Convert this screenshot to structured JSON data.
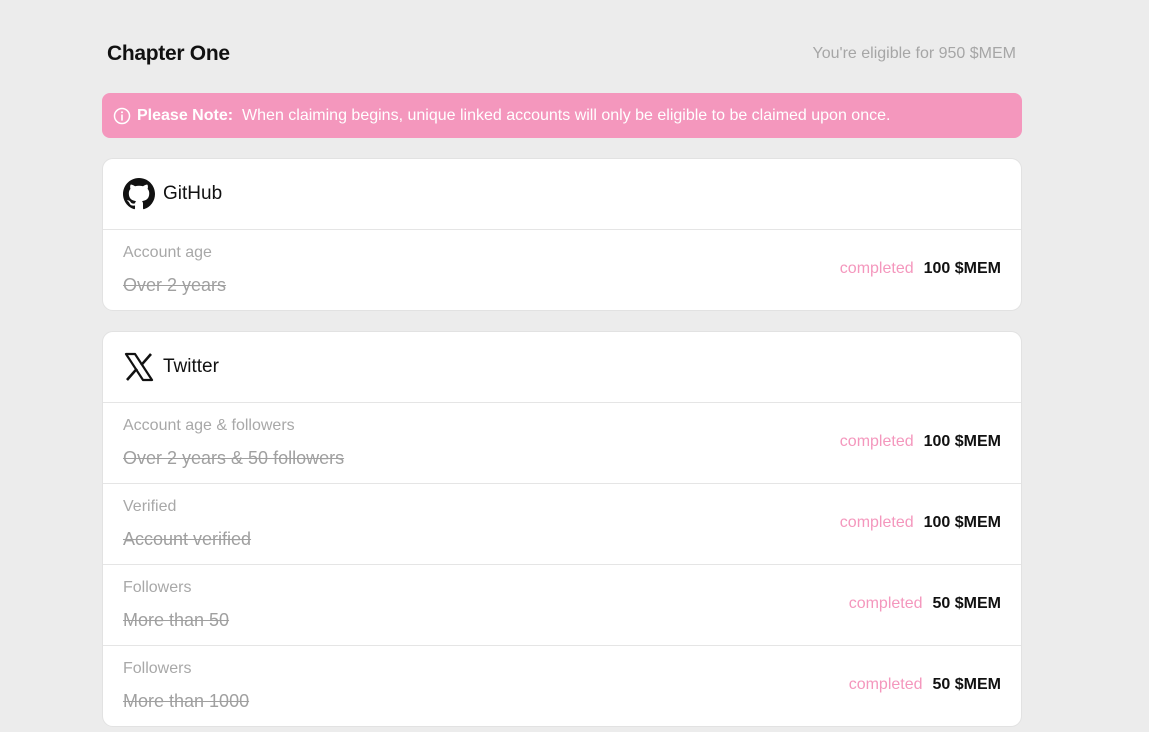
{
  "header": {
    "title": "Chapter One",
    "eligibility": "You're eligible for 950 $MEM"
  },
  "note": {
    "icon": "info-icon",
    "label": "Please Note:",
    "text": "When claiming begins, unique linked accounts will only be eligible to be claimed upon once."
  },
  "github": {
    "icon": "github-icon",
    "name": "GitHub",
    "tasks": [
      {
        "label": "Account age",
        "requirement": "Over 2 years",
        "status": "completed",
        "reward": "100 $MEM"
      }
    ]
  },
  "twitter": {
    "icon": "x-icon",
    "name": "Twitter",
    "tasks": [
      {
        "label": "Account age & followers",
        "requirement": "Over 2 years & 50 followers",
        "status": "completed",
        "reward": "100 $MEM"
      },
      {
        "label": "Verified",
        "requirement": "Account verified",
        "status": "completed",
        "reward": "100 $MEM"
      },
      {
        "label": "Followers",
        "requirement": "More than 50",
        "status": "completed",
        "reward": "50 $MEM"
      },
      {
        "label": "Followers",
        "requirement": "More than 1000",
        "status": "completed",
        "reward": "50 $MEM"
      }
    ]
  },
  "colors": {
    "background": "#ececec",
    "accent": "#f497bd",
    "card": "#ffffff"
  }
}
